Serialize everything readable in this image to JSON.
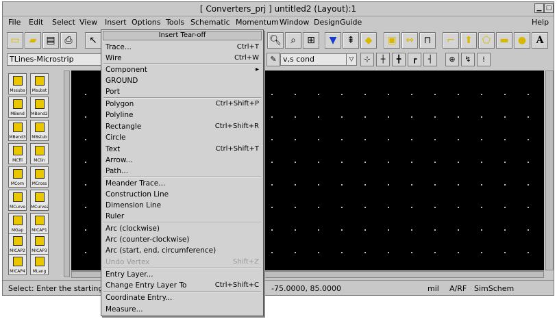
{
  "window": {
    "title": "[ Converters_prj ] untitled2 (Layout):1"
  },
  "menubar": [
    "File",
    "Edit",
    "Select",
    "View",
    "Insert",
    "Options",
    "Tools",
    "Schematic",
    "Momentum",
    "Window",
    "DesignGuide",
    "Help"
  ],
  "palette": {
    "selected": "TLines-Microstrip",
    "items": [
      "Mssubs",
      "Msubst",
      "MBend",
      "MBend2",
      "MBend3",
      "MBstub",
      "MCfil",
      "MClin",
      "MCorn",
      "MCross",
      "MCurve",
      "MCurve2",
      "MGap",
      "MICAP1",
      "MICAP2",
      "MICAP3",
      "MICAP4",
      "MLang"
    ]
  },
  "cond_field": "v,s cond",
  "insert_menu": {
    "tearoff": "Insert Tear-off",
    "items": [
      {
        "label": "Trace...",
        "acc": "Ctrl+T"
      },
      {
        "label": "Wire",
        "acc": "Ctrl+W"
      },
      {
        "label": "Component",
        "acc": "▸"
      },
      {
        "label": "GROUND",
        "acc": ""
      },
      {
        "label": "Port",
        "acc": ""
      },
      {
        "label": "Polygon",
        "acc": "Ctrl+Shift+P"
      },
      {
        "label": "Polyline",
        "acc": ""
      },
      {
        "label": "Rectangle",
        "acc": "Ctrl+Shift+R"
      },
      {
        "label": "Circle",
        "acc": ""
      },
      {
        "label": "Text",
        "acc": "Ctrl+Shift+T"
      },
      {
        "label": "Arrow...",
        "acc": ""
      },
      {
        "label": "Path...",
        "acc": ""
      },
      {
        "label": "Meander Trace...",
        "acc": ""
      },
      {
        "label": "Construction Line",
        "acc": ""
      },
      {
        "label": "Dimension Line",
        "acc": ""
      },
      {
        "label": "Ruler",
        "acc": ""
      },
      {
        "label": "Arc (clockwise)",
        "acc": ""
      },
      {
        "label": "Arc (counter-clockwise)",
        "acc": ""
      },
      {
        "label": "Arc (start, end, circumference)",
        "acc": ""
      },
      {
        "label": "Undo Vertex",
        "acc": "Shift+Z"
      },
      {
        "label": "Entry Layer...",
        "acc": ""
      },
      {
        "label": "Change Entry Layer To",
        "acc": "Ctrl+Shift+C"
      },
      {
        "label": "Coordinate Entry...",
        "acc": ""
      },
      {
        "label": "Measure...",
        "acc": ""
      }
    ]
  },
  "status": {
    "message": "Select: Enter the starting po",
    "coords": "-75.0000, 85.0000",
    "units": "mil",
    "layer": "A/RF",
    "mode": "SimSchem"
  },
  "colors": {
    "menu_bg": "#d2d2d2",
    "canvas_bg": "#000000",
    "chrome": "#c8c8c8",
    "icon_yellow": "#e8c600"
  }
}
